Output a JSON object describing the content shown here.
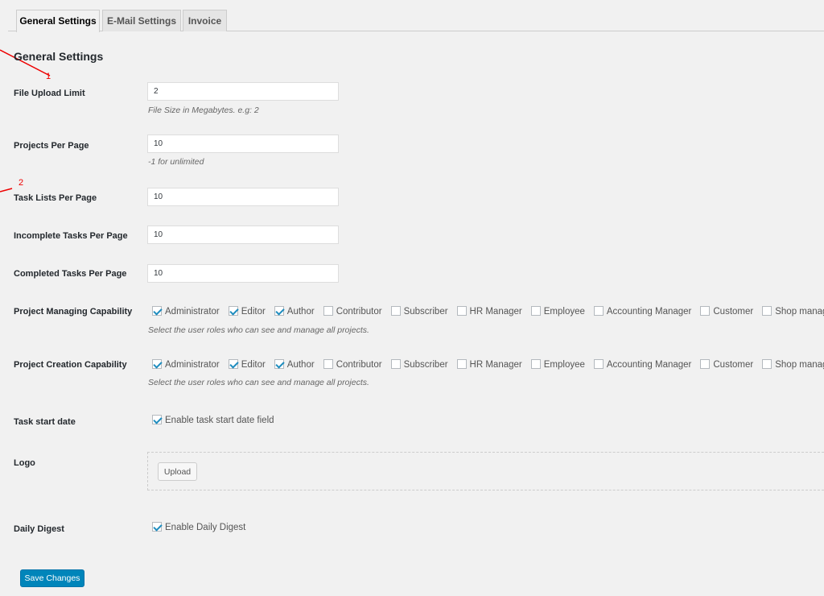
{
  "tabs": [
    {
      "label": "General Settings",
      "active": true
    },
    {
      "label": "E-Mail Settings",
      "active": false
    },
    {
      "label": "Invoice",
      "active": false
    }
  ],
  "section_title": "General Settings",
  "annotations": {
    "one": "1",
    "two": "2",
    "color": "#ee0000"
  },
  "fields": {
    "file_upload_limit": {
      "label": "File Upload Limit",
      "value": "2",
      "description": "File Size in Megabytes. e.g: 2"
    },
    "projects_per_page": {
      "label": "Projects Per Page",
      "value": "10",
      "description": "-1 for unlimited"
    },
    "task_lists_per_page": {
      "label": "Task Lists Per Page",
      "value": "10"
    },
    "incomplete_tasks_per_page": {
      "label": "Incomplete Tasks Per Page",
      "value": "10"
    },
    "completed_tasks_per_page": {
      "label": "Completed Tasks Per Page",
      "value": "10"
    }
  },
  "project_managing": {
    "label": "Project Managing Capability",
    "description": "Select the user roles who can see and manage all projects.",
    "roles": [
      {
        "label": "Administrator",
        "checked": true
      },
      {
        "label": "Editor",
        "checked": true
      },
      {
        "label": "Author",
        "checked": true
      },
      {
        "label": "Contributor",
        "checked": false
      },
      {
        "label": "Subscriber",
        "checked": false
      },
      {
        "label": "HR Manager",
        "checked": false
      },
      {
        "label": "Employee",
        "checked": false
      },
      {
        "label": "Accounting Manager",
        "checked": false
      },
      {
        "label": "Customer",
        "checked": false
      },
      {
        "label": "Shop manager",
        "checked": false
      }
    ]
  },
  "project_creation": {
    "label": "Project Creation Capability",
    "description": "Select the user roles who can see and manage all projects.",
    "roles": [
      {
        "label": "Administrator",
        "checked": true
      },
      {
        "label": "Editor",
        "checked": true
      },
      {
        "label": "Author",
        "checked": true
      },
      {
        "label": "Contributor",
        "checked": false
      },
      {
        "label": "Subscriber",
        "checked": false
      },
      {
        "label": "HR Manager",
        "checked": false
      },
      {
        "label": "Employee",
        "checked": false
      },
      {
        "label": "Accounting Manager",
        "checked": false
      },
      {
        "label": "Customer",
        "checked": false
      },
      {
        "label": "Shop manager",
        "checked": false
      }
    ]
  },
  "task_start_date": {
    "label": "Task start date",
    "checkbox_label": "Enable task start date field",
    "checked": true
  },
  "logo": {
    "label": "Logo",
    "button_label": "Upload"
  },
  "daily_digest": {
    "label": "Daily Digest",
    "checkbox_label": "Enable Daily Digest",
    "checked": true
  },
  "save_button": "Save Changes",
  "colors": {
    "primary_button": "#0085ba",
    "checkbox_check": "#1e8cbe",
    "background": "#f1f1f1"
  }
}
